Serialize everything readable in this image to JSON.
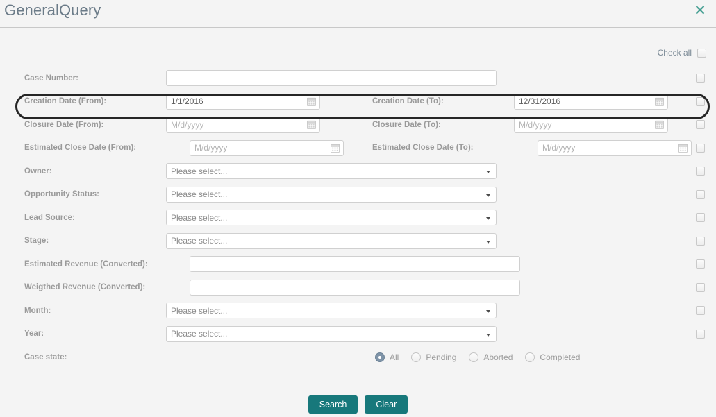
{
  "dialog": {
    "title": "GeneralQuery",
    "close_icon": "close-icon"
  },
  "check_all": {
    "label": "Check all"
  },
  "colors": {
    "accent_button": "#17787b",
    "close_icon": "#3f9c8f",
    "title": "#6b7b88",
    "label": "#9a9a9a",
    "background": "#f4f4f4",
    "radio_selected": "#7f94a8",
    "highlight_ring": "#262626"
  },
  "fields": [
    {
      "left": {
        "label": "Case Number:",
        "type": "text",
        "value": "",
        "placeholder": ""
      },
      "right": null
    },
    {
      "left": {
        "label": "Creation Date (From):",
        "type": "date",
        "value": "1/1/2016",
        "placeholder": "M/d/yyyy"
      },
      "right": {
        "label": "Creation Date (To):",
        "type": "date",
        "value": "12/31/2016",
        "placeholder": "M/d/yyyy"
      },
      "highlighted": true
    },
    {
      "left": {
        "label": "Closure Date (From):",
        "type": "date",
        "value": "",
        "placeholder": "M/d/yyyy"
      },
      "right": {
        "label": "Closure Date (To):",
        "type": "date",
        "value": "",
        "placeholder": "M/d/yyyy"
      }
    },
    {
      "left": {
        "label": "Estimated Close Date (From):",
        "type": "date",
        "value": "",
        "placeholder": "M/d/yyyy"
      },
      "right": {
        "label": "Estimated Close Date (To):",
        "type": "date",
        "value": "",
        "placeholder": "M/d/yyyy"
      }
    },
    {
      "left": {
        "label": "Owner:",
        "type": "select",
        "value": "Please select..."
      },
      "right": null
    },
    {
      "left": {
        "label": "Opportunity Status:",
        "type": "select",
        "value": "Please select..."
      },
      "right": null
    },
    {
      "left": {
        "label": "Lead Source:",
        "type": "select",
        "value": "Please select..."
      },
      "right": null
    },
    {
      "left": {
        "label": "Stage:",
        "type": "select",
        "value": "Please select..."
      },
      "right": null
    },
    {
      "left": {
        "label": "Estimated Revenue (Converted):",
        "type": "text",
        "value": "",
        "placeholder": ""
      },
      "right": null
    },
    {
      "left": {
        "label": "Weigthed Revenue (Converted):",
        "type": "text",
        "value": "",
        "placeholder": ""
      },
      "right": null
    },
    {
      "left": {
        "label": "Month:",
        "type": "select",
        "value": "Please select..."
      },
      "right": null
    },
    {
      "left": {
        "label": "Year:",
        "type": "select",
        "value": "Please select..."
      },
      "right": null
    }
  ],
  "case_state": {
    "label": "Case state:",
    "options": [
      {
        "label": "All",
        "selected": true
      },
      {
        "label": "Pending",
        "selected": false
      },
      {
        "label": "Aborted",
        "selected": false
      },
      {
        "label": "Completed",
        "selected": false
      }
    ]
  },
  "buttons": {
    "search": "Search",
    "clear": "Clear"
  }
}
